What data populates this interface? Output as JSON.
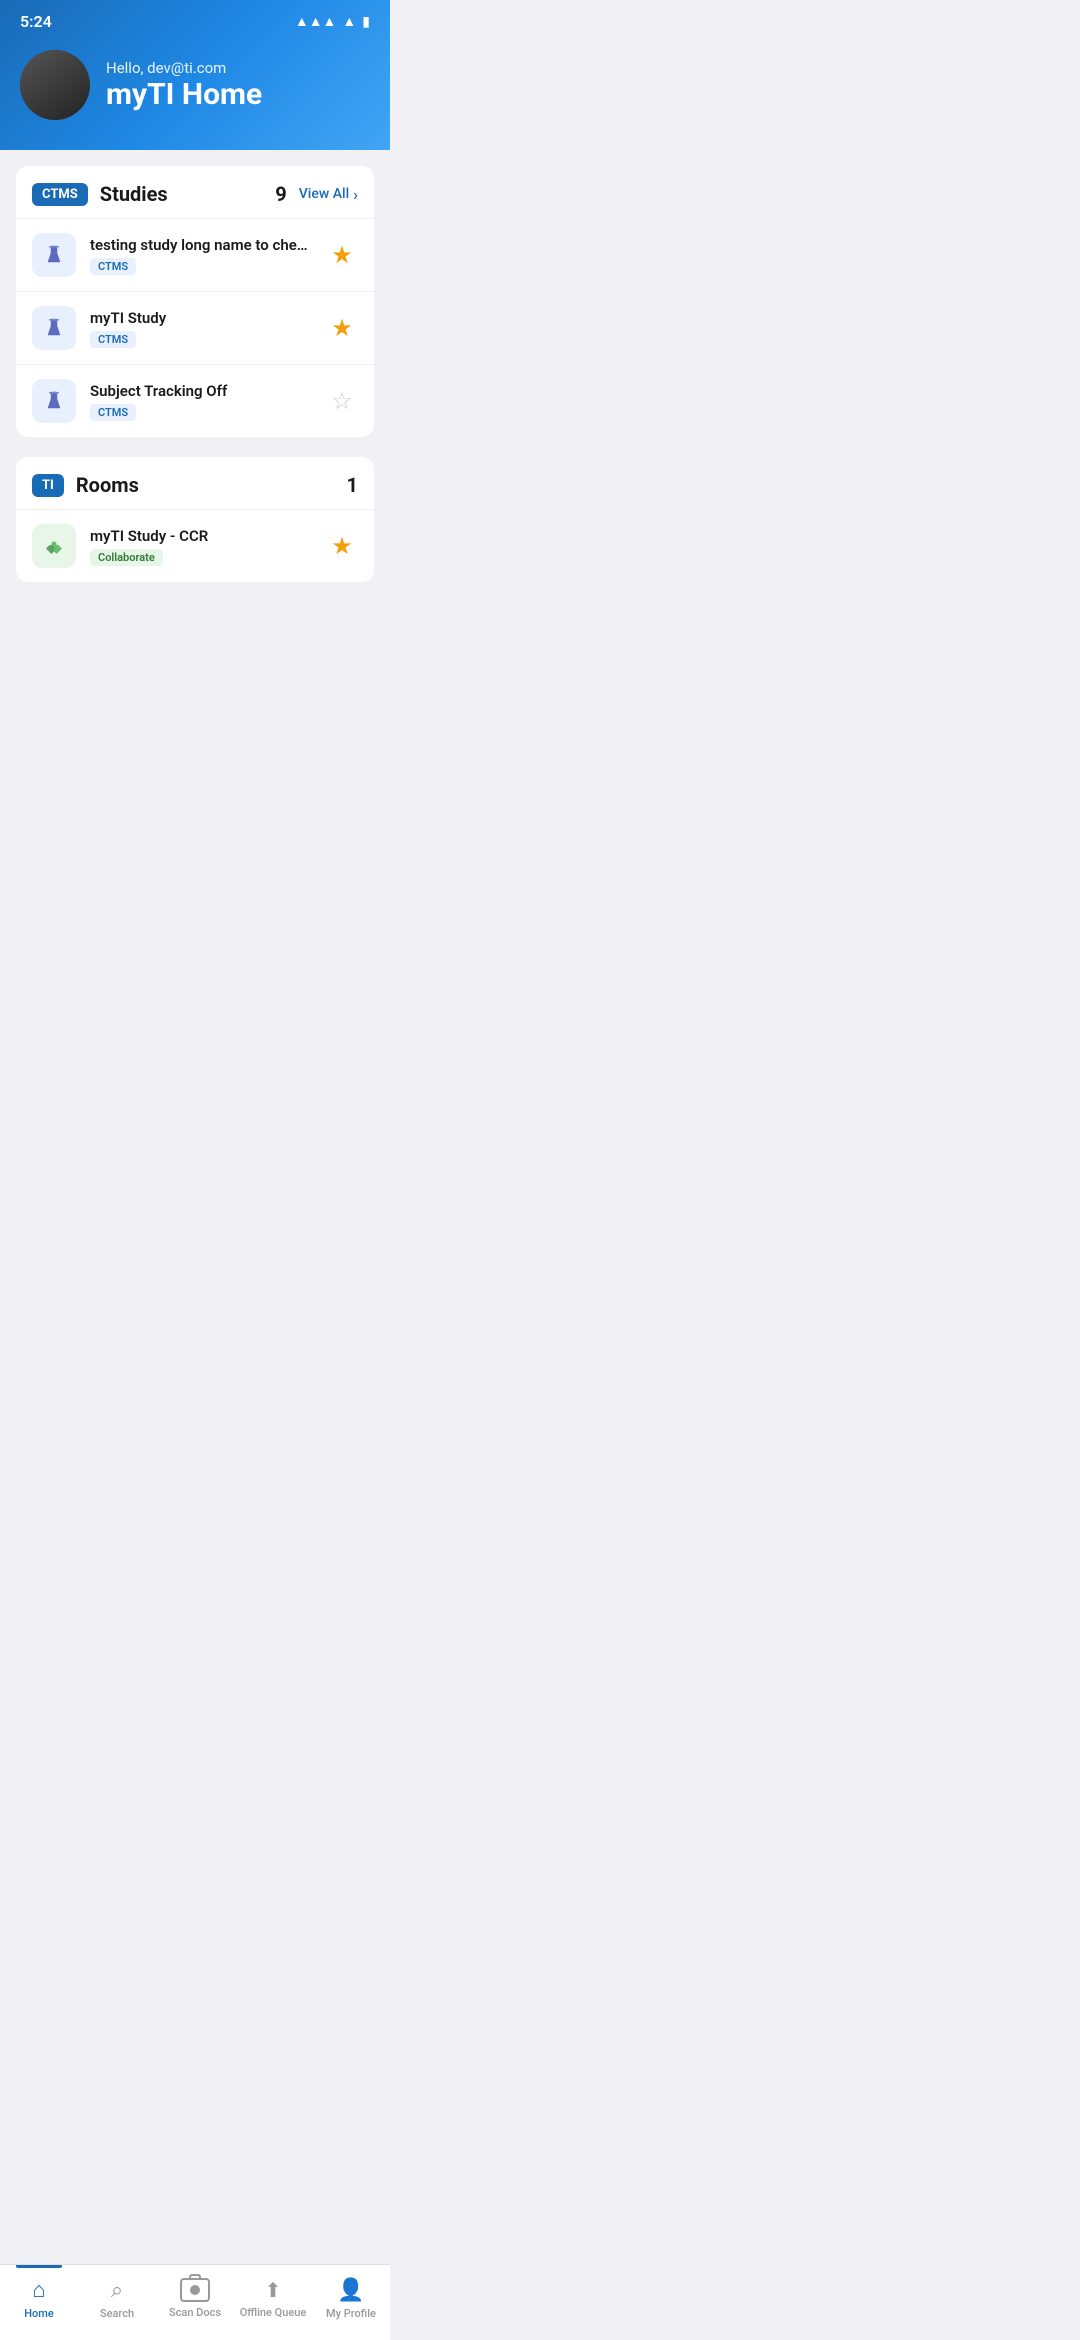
{
  "statusBar": {
    "time": "5:24",
    "icons": [
      "signal",
      "wifi",
      "battery"
    ]
  },
  "header": {
    "greeting": "Hello, dev@ti.com",
    "title": "myTI Home"
  },
  "studies": {
    "badge": "CTMS",
    "title": "Studies",
    "count": 9,
    "viewAllLabel": "View All",
    "items": [
      {
        "name": "testing study long name to che…",
        "tag": "CTMS",
        "starred": true
      },
      {
        "name": "myTI Study",
        "tag": "CTMS",
        "starred": true
      },
      {
        "name": "Subject Tracking Off",
        "tag": "CTMS",
        "starred": false
      }
    ]
  },
  "rooms": {
    "badge": "TI",
    "title": "Rooms",
    "count": 1,
    "items": [
      {
        "name": "myTI Study - CCR",
        "tag": "Collaborate",
        "starred": true
      }
    ]
  },
  "bottomNav": {
    "items": [
      {
        "label": "Home",
        "icon": "home",
        "active": true
      },
      {
        "label": "Search",
        "icon": "search",
        "active": false
      },
      {
        "label": "Scan Docs",
        "icon": "scan",
        "active": false
      },
      {
        "label": "Offline Queue",
        "icon": "upload",
        "active": false
      },
      {
        "label": "My Profile",
        "icon": "person",
        "active": false
      }
    ]
  }
}
